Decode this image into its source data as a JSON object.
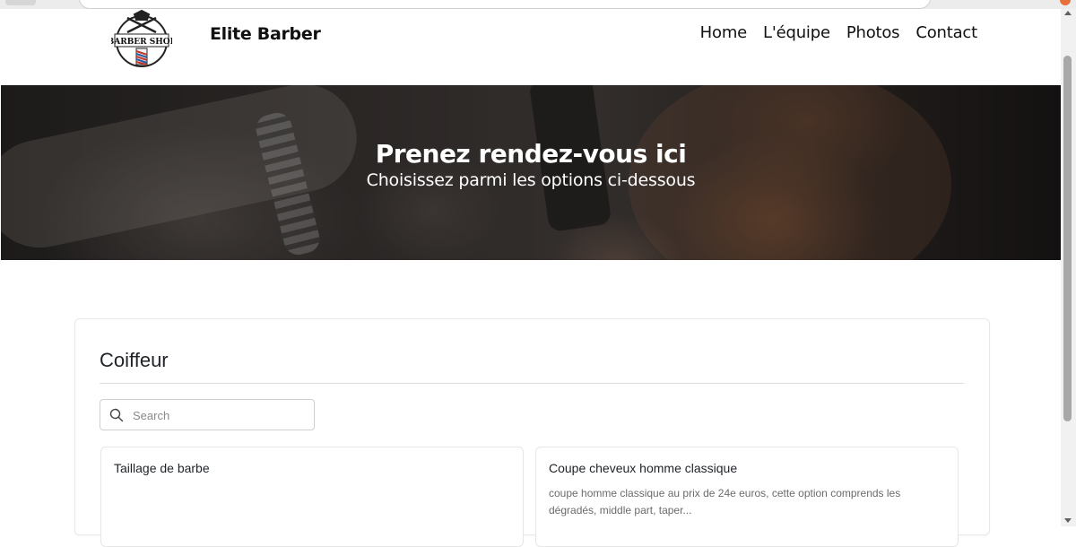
{
  "header": {
    "brand": "Elite Barber",
    "logo_text": "BARBER SHOP",
    "nav": [
      "Home",
      "L'équipe",
      "Photos",
      "Contact"
    ]
  },
  "hero": {
    "title": "Prenez rendez-vous ici",
    "subtitle": "Choisissez parmi les options ci-dessous"
  },
  "section": {
    "title": "Coiffeur",
    "search_placeholder": "Search",
    "services": [
      {
        "name": "Taillage de barbe",
        "description": ""
      },
      {
        "name": "Coupe cheveux homme classique",
        "description": "coupe homme classique au prix de 24e euros, cette option comprends les dégradés, middle part, taper..."
      }
    ]
  },
  "colors": {
    "text": "#1f2328",
    "muted": "#6b6b6b",
    "border": "#e6e6e6",
    "hero_text": "#ffffff"
  },
  "icons": {
    "search": "search-icon",
    "logo": "barber-shop-logo"
  }
}
